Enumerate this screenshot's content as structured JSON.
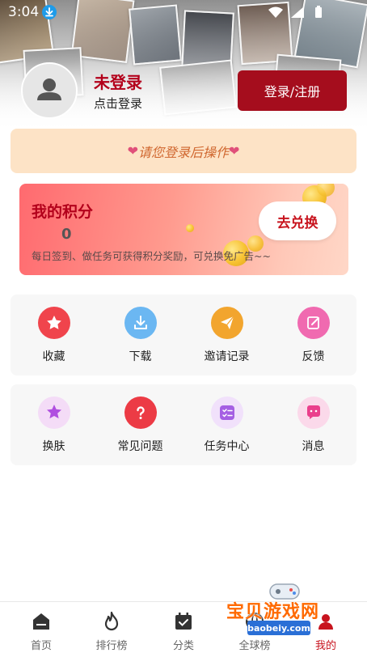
{
  "status_bar": {
    "time": "3:04"
  },
  "profile": {
    "name": "未登录",
    "subtitle": "点击登录",
    "login_button": "登录/注册"
  },
  "tip": {
    "text": "请您登录后操作"
  },
  "points": {
    "title": "我的积分",
    "value": "0",
    "description": "每日签到、做任务可获得积分奖励，可兑换免广告~~",
    "redeem_button": "去兑换"
  },
  "grid_top": [
    {
      "label": "收藏",
      "icon": "star-icon",
      "color": "#f0444c"
    },
    {
      "label": "下载",
      "icon": "download-icon",
      "color": "#6bb7f2"
    },
    {
      "label": "邀请记录",
      "icon": "paper-plane-icon",
      "color": "#f2a52e"
    },
    {
      "label": "反馈",
      "icon": "edit-icon",
      "color": "#f06ab0"
    }
  ],
  "grid_bottom": [
    {
      "label": "换肤",
      "icon": "skin-icon",
      "color": "#b04fe0"
    },
    {
      "label": "常见问题",
      "icon": "question-icon",
      "color": "#ec3b45"
    },
    {
      "label": "任务中心",
      "icon": "task-list-icon",
      "color": "#a55fe3"
    },
    {
      "label": "消息",
      "icon": "message-icon",
      "color": "#ea3f8c"
    }
  ],
  "bottom_nav": [
    {
      "label": "首页",
      "icon": "home-icon"
    },
    {
      "label": "排行榜",
      "icon": "fire-icon"
    },
    {
      "label": "分类",
      "icon": "calendar-icon"
    },
    {
      "label": "全球榜",
      "icon": "globe-icon"
    },
    {
      "label": "我的",
      "icon": "user-icon"
    }
  ],
  "watermark": {
    "text": "宝贝游戏网",
    "url": "baobeiy.com"
  },
  "colors": {
    "brand": "#a50d1d",
    "accent_red": "#b3001b",
    "tip_bg": "#fde3c6"
  }
}
